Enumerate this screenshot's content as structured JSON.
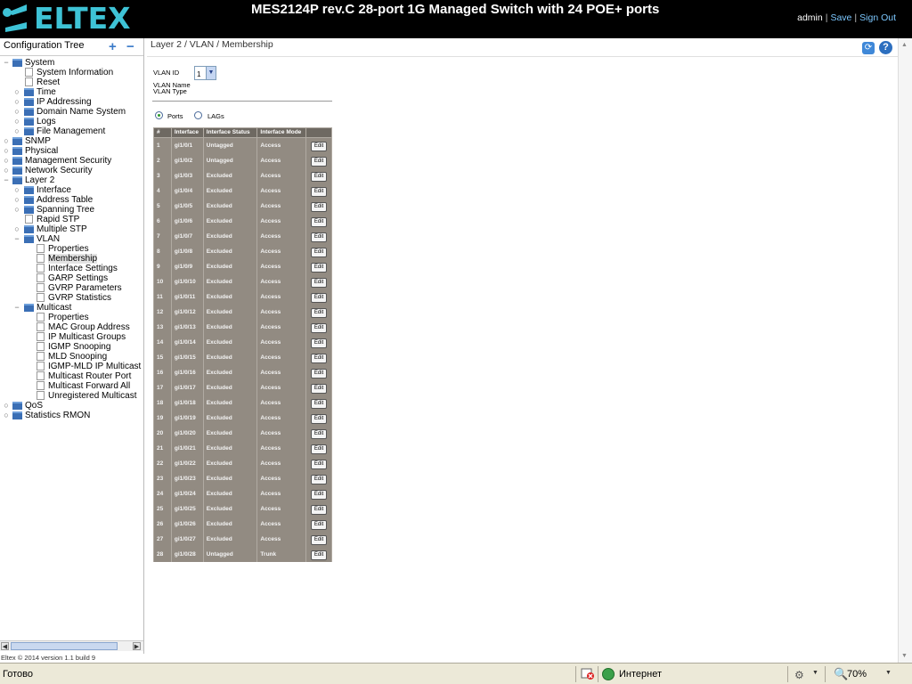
{
  "header": {
    "logo_text": "ELTEX",
    "title": "MES2124P rev.C 28-port 1G Managed Switch with 24 POE+ ports",
    "user": "admin",
    "save_label": "Save",
    "signout_label": "Sign Out",
    "separator": "|"
  },
  "tree": {
    "title": "Configuration Tree",
    "expand_label": "+",
    "collapse_label": "−",
    "nodes": {
      "system": "System",
      "system_information": "System Information",
      "reset": "Reset",
      "time": "Time",
      "ip_addressing": "IP Addressing",
      "dns": "Domain Name System",
      "logs": "Logs",
      "file_management": "File Management",
      "snmp": "SNMP",
      "physical": "Physical",
      "management_security": "Management Security",
      "network_security": "Network Security",
      "layer2": "Layer 2",
      "interface": "Interface",
      "address_table": "Address Table",
      "spanning_tree": "Spanning Tree",
      "rapid_stp": "Rapid STP",
      "multiple_stp": "Multiple STP",
      "vlan": "VLAN",
      "vlan_properties": "Properties",
      "vlan_membership": "Membership",
      "vlan_interface_settings": "Interface Settings",
      "garp_settings": "GARP Settings",
      "gvrp_parameters": "GVRP Parameters",
      "gvrp_statistics": "GVRP Statistics",
      "multicast": "Multicast",
      "mc_properties": "Properties",
      "mac_group_address": "MAC Group Address",
      "ip_multicast_groups": "IP Multicast Groups",
      "igmp_snooping": "IGMP Snooping",
      "mld_snooping": "MLD Snooping",
      "igmp_mld_ip_multicast": "IGMP-MLD IP Multicast G",
      "multicast_router_port": "Multicast Router Port",
      "multicast_forward_all": "Multicast Forward All",
      "unregistered_multicast": "Unregistered Multicast",
      "qos": "QoS",
      "statistics_rmon": "Statistics RMON"
    }
  },
  "copyright": "Eltex © 2014 version 1.1 build 9",
  "main": {
    "breadcrumb": "Layer 2 / VLAN / Membership",
    "vlan_id_label": "VLAN ID",
    "vlan_id_value": "1",
    "vlan_name_label": "VLAN Name",
    "vlan_type_label": "VLAN Type",
    "radio_ports": "Ports",
    "radio_lags": "LAGs",
    "table": {
      "headers": [
        "#",
        "Interface",
        "Interface Status",
        "Interface Mode",
        ""
      ],
      "edit_label": "Edit",
      "rows": [
        [
          "1",
          "gi1/0/1",
          "Untagged",
          "Access"
        ],
        [
          "2",
          "gi1/0/2",
          "Untagged",
          "Access"
        ],
        [
          "3",
          "gi1/0/3",
          "Excluded",
          "Access"
        ],
        [
          "4",
          "gi1/0/4",
          "Excluded",
          "Access"
        ],
        [
          "5",
          "gi1/0/5",
          "Excluded",
          "Access"
        ],
        [
          "6",
          "gi1/0/6",
          "Excluded",
          "Access"
        ],
        [
          "7",
          "gi1/0/7",
          "Excluded",
          "Access"
        ],
        [
          "8",
          "gi1/0/8",
          "Excluded",
          "Access"
        ],
        [
          "9",
          "gi1/0/9",
          "Excluded",
          "Access"
        ],
        [
          "10",
          "gi1/0/10",
          "Excluded",
          "Access"
        ],
        [
          "11",
          "gi1/0/11",
          "Excluded",
          "Access"
        ],
        [
          "12",
          "gi1/0/12",
          "Excluded",
          "Access"
        ],
        [
          "13",
          "gi1/0/13",
          "Excluded",
          "Access"
        ],
        [
          "14",
          "gi1/0/14",
          "Excluded",
          "Access"
        ],
        [
          "15",
          "gi1/0/15",
          "Excluded",
          "Access"
        ],
        [
          "16",
          "gi1/0/16",
          "Excluded",
          "Access"
        ],
        [
          "17",
          "gi1/0/17",
          "Excluded",
          "Access"
        ],
        [
          "18",
          "gi1/0/18",
          "Excluded",
          "Access"
        ],
        [
          "19",
          "gi1/0/19",
          "Excluded",
          "Access"
        ],
        [
          "20",
          "gi1/0/20",
          "Excluded",
          "Access"
        ],
        [
          "21",
          "gi1/0/21",
          "Excluded",
          "Access"
        ],
        [
          "22",
          "gi1/0/22",
          "Excluded",
          "Access"
        ],
        [
          "23",
          "gi1/0/23",
          "Excluded",
          "Access"
        ],
        [
          "24",
          "gi1/0/24",
          "Excluded",
          "Access"
        ],
        [
          "25",
          "gi1/0/25",
          "Excluded",
          "Access"
        ],
        [
          "26",
          "gi1/0/26",
          "Excluded",
          "Access"
        ],
        [
          "27",
          "gi1/0/27",
          "Excluded",
          "Access"
        ],
        [
          "28",
          "gi1/0/28",
          "Untagged",
          "Trunk"
        ]
      ]
    }
  },
  "statusbar": {
    "status": "Готово",
    "zone": "Интернет",
    "zoom": "70%"
  },
  "colors": {
    "header_bg": "#000000",
    "logo": "#3ec3d6",
    "table_body": "#928b82",
    "table_header": "#6e6962"
  }
}
